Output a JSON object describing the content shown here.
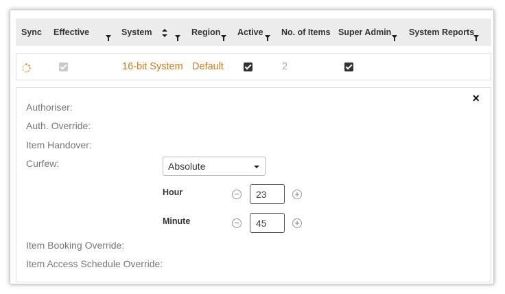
{
  "table": {
    "headers": {
      "sync": "Sync",
      "effective": "Effective",
      "system": "System",
      "region": "Region",
      "active": "Active",
      "no_of_items": "No. of Items",
      "super_admin": "Super Admin",
      "system_reports": "System Reports"
    },
    "row": {
      "sync_status": "loading",
      "effective_checked": true,
      "system": "16-bit System",
      "region": "Default",
      "active_checked": true,
      "no_of_items": "2",
      "super_admin_checked": true
    }
  },
  "detail": {
    "close_symbol": "×",
    "labels": {
      "authoriser": "Authoriser:",
      "auth_override": "Auth. Override:",
      "item_handover": "Item Handover:",
      "curfew": "Curfew:",
      "item_booking_override": "Item Booking Override:",
      "item_access_schedule_override": "Item Access Schedule Override:"
    },
    "curfew": {
      "mode": "Absolute",
      "hour_label": "Hour",
      "hour_value": "23",
      "minute_label": "Minute",
      "minute_value": "45"
    }
  },
  "colors": {
    "accent": "#c87f2a",
    "header_bg": "#ececec"
  },
  "icons": [
    "spinner-icon",
    "filter-icon",
    "sort-icon",
    "close-icon",
    "minus-circle-icon",
    "plus-circle-icon",
    "caret-down-icon"
  ]
}
